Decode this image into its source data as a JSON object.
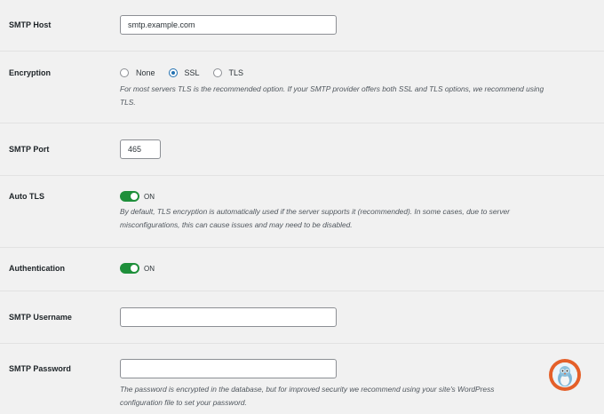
{
  "smtp_host": {
    "label": "SMTP Host",
    "value": "smtp.example.com"
  },
  "encryption": {
    "label": "Encryption",
    "options": [
      "None",
      "SSL",
      "TLS"
    ],
    "selected": "SSL",
    "description": "For most servers TLS is the recommended option. If your SMTP provider offers both SSL and TLS options, we recommend using TLS."
  },
  "smtp_port": {
    "label": "SMTP Port",
    "value": "465"
  },
  "auto_tls": {
    "label": "Auto TLS",
    "state_label": "ON",
    "enabled": true,
    "description": "By default, TLS encryption is automatically used if the server supports it (recommended). In some cases, due to server misconfigurations, this can cause issues and may need to be disabled."
  },
  "authentication": {
    "label": "Authentication",
    "state_label": "ON",
    "enabled": true
  },
  "smtp_username": {
    "label": "SMTP Username",
    "value": ""
  },
  "smtp_password": {
    "label": "SMTP Password",
    "value": "",
    "description": "The password is encrypted in the database, but for improved security we recommend using your site's WordPress configuration file to set your password."
  },
  "colors": {
    "accent": "#2271b1",
    "toggle_on": "#1e8f3a",
    "help_button": "#e4602a",
    "background": "#f1f1f1"
  },
  "help_button": {
    "icon": "mascot-bird-icon"
  }
}
